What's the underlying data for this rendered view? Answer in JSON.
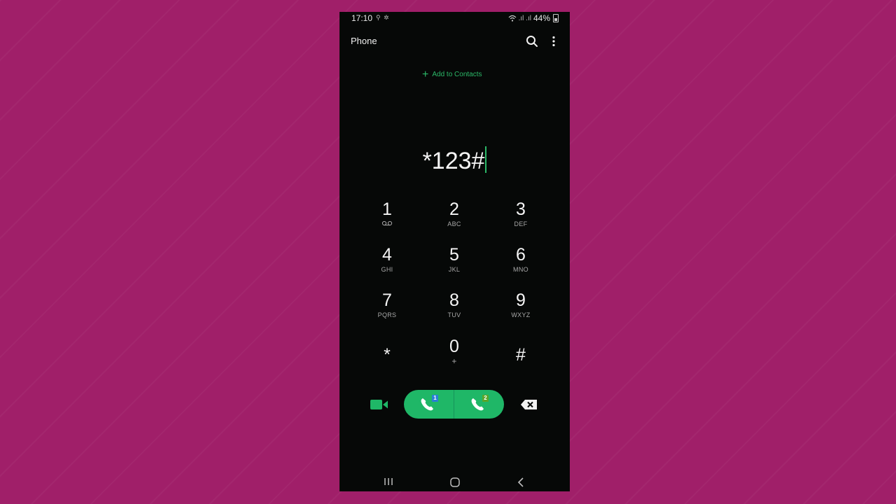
{
  "status_bar": {
    "time": "17:10",
    "battery": "44%"
  },
  "app_bar": {
    "title": "Phone",
    "search_icon": "search-icon",
    "more_icon": "more-vert-icon"
  },
  "add_to_contacts": {
    "label": "Add to Contacts",
    "icon": "plus-icon"
  },
  "dialed_number": "*123#",
  "keypad": [
    {
      "digit": "1",
      "letters": "",
      "icon": "voicemail-icon"
    },
    {
      "digit": "2",
      "letters": "ABC"
    },
    {
      "digit": "3",
      "letters": "DEF"
    },
    {
      "digit": "4",
      "letters": "GHI"
    },
    {
      "digit": "5",
      "letters": "JKL"
    },
    {
      "digit": "6",
      "letters": "MNO"
    },
    {
      "digit": "7",
      "letters": "PQRS"
    },
    {
      "digit": "8",
      "letters": "TUV"
    },
    {
      "digit": "9",
      "letters": "WXYZ"
    },
    {
      "digit": "*",
      "letters": ""
    },
    {
      "digit": "0",
      "letters": "+"
    },
    {
      "digit": "#",
      "letters": ""
    }
  ],
  "actions": {
    "video_call_icon": "video-call-icon",
    "call_sim1_badge": "1",
    "call_sim2_badge": "2",
    "backspace_icon": "backspace-icon"
  },
  "colors": {
    "accent_green": "#1fb767",
    "sim1_badge": "#2a7fd6",
    "sim2_badge": "#5aa52a",
    "background": "#a01f69"
  }
}
